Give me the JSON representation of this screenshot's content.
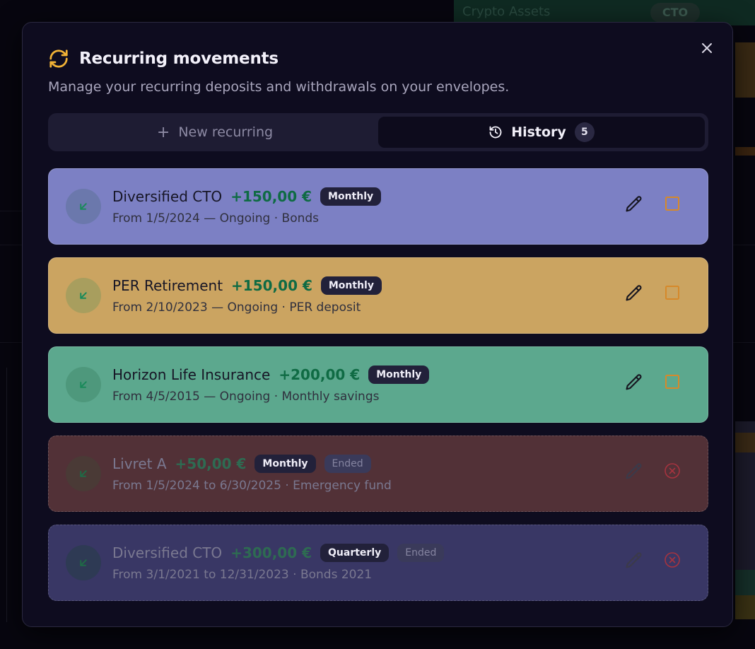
{
  "background": {
    "crypto_label": "Crypto Assets",
    "cto_tag": "CTO"
  },
  "modal": {
    "title": "Recurring movements",
    "subtitle": "Manage your recurring deposits and withdrawals on your envelopes.",
    "title_icon": "refresh-icon",
    "close_icon": "close-icon",
    "tabs": {
      "new_label": "New recurring",
      "history_label": "History",
      "history_count": "5"
    },
    "movements": [
      {
        "name": "Diversified CTO",
        "amount": "+150,00 €",
        "frequency": "Monthly",
        "detail": "From 1/5/2024 — Ongoing · Bonds",
        "ended": false,
        "bg_color": "#7c80c4",
        "icon_bg": "#6b78ac",
        "icon_color": "#1a8a5a"
      },
      {
        "name": "PER Retirement",
        "amount": "+150,00 €",
        "frequency": "Monthly",
        "detail": "From 2/10/2023 — Ongoing · PER deposit",
        "ended": false,
        "bg_color": "#cba461",
        "icon_bg": "#a89e5e",
        "icon_color": "#1a8a5a"
      },
      {
        "name": "Horizon Life Insurance",
        "amount": "+200,00 €",
        "frequency": "Monthly",
        "detail": "From 4/5/2015 — Ongoing · Monthly savings",
        "ended": false,
        "bg_color": "#5ca88e",
        "icon_bg": "#4e987c",
        "icon_color": "#1a8a5a"
      },
      {
        "name": "Livret A",
        "amount": "+50,00 €",
        "frequency": "Monthly",
        "status": "Ended",
        "detail": "From 1/5/2024 to 6/30/2025 · Emergency fund",
        "ended": true,
        "bg_color": "#523137",
        "icon_bg": "#4a3a36",
        "icon_color": "#1f6a46"
      },
      {
        "name": "Diversified CTO",
        "amount": "+300,00 €",
        "frequency": "Quarterly",
        "status": "Ended",
        "detail": "From 3/1/2021 to 12/31/2023 · Bonds 2021",
        "ended": true,
        "bg_color": "#393765",
        "icon_bg": "#2e3a54",
        "icon_color": "#1f6a46"
      }
    ]
  },
  "colors": {
    "modal_bg": "#0e0c1f",
    "accent_icon": "#f2b336",
    "toggle_active": "#d6892a",
    "toggle_ended": "#a6333f"
  }
}
